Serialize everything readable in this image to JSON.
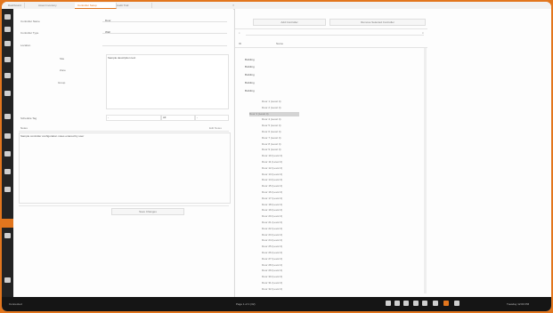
{
  "tabs": [
    "Dashboard",
    "Asset Inventory",
    "Controller Setup",
    "Audit Trail"
  ],
  "active_tab": 2,
  "sidebar": {
    "icon_count": 14,
    "active_index": 11
  },
  "form": {
    "field1_label": "Controller Name",
    "field1_value": "Door",
    "field2_label": "Controller Type",
    "field2_value": "Wall",
    "field3_label": "Location",
    "sub_label_1": "Site",
    "sub_label_2": "Zone",
    "sub_label_3": "Group",
    "textarea_value": "Sample description text",
    "field4_label": "Schedule Tag",
    "filter_left": "-",
    "filter_mid": "All",
    "filter_right": "-",
    "notes_label": "Notes",
    "notes_link": "Edit Notes",
    "notes_value": "Sample controller configuration notes entered by user",
    "save_label": "Save Changes"
  },
  "right": {
    "btn_left": "Add Controller",
    "btn_right": "Remove Selected Controller",
    "col_a": "ID",
    "col_b": "Name",
    "groups": [
      "Building",
      "Building",
      "Building",
      "Building",
      "Building"
    ],
    "leaves": [
      "Door 1 (Level 4)",
      "Door 2 (Level 4)",
      "Door 3 (Level 4)",
      "Door 4 (Level 4)",
      "Door 5 (Level 4)",
      "Door 6 (Level 4)",
      "Door 7 (Level 4)",
      "Door 8 (Level 4)",
      "Door 9 (Level 4)",
      "Door 10 (Level 4)",
      "Door 11 (Level 4)",
      "Door 12 (Level 4)",
      "Door 13 (Level 4)",
      "Door 14 (Level 4)",
      "Door 15 (Level 4)",
      "Door 16 (Level 4)",
      "Door 17 (Level 4)",
      "Door 18 (Level 4)",
      "Door 19 (Level 4)",
      "Door 20 (Level 4)",
      "Door 21 (Level 4)",
      "Door 22 (Level 4)",
      "Door 23 (Level 4)",
      "Door 24 (Level 4)",
      "Door 25 (Level 4)",
      "Door 26 (Level 4)",
      "Door 27 (Level 4)",
      "Door 28 (Level 4)",
      "Door 29 (Level 4)",
      "Door 30 (Level 4)",
      "Door 31 (Level 4)",
      "Door 32 (Level 4)"
    ],
    "selected_leaf": 2
  },
  "status": {
    "left": "Connected",
    "mid_left": "",
    "center": "Page 1 of 1 (32)",
    "right": "Tuesday 12:00 PM"
  },
  "colors": {
    "accent": "#e2761e",
    "sidebar": "#232323",
    "statusbar": "#151515"
  }
}
